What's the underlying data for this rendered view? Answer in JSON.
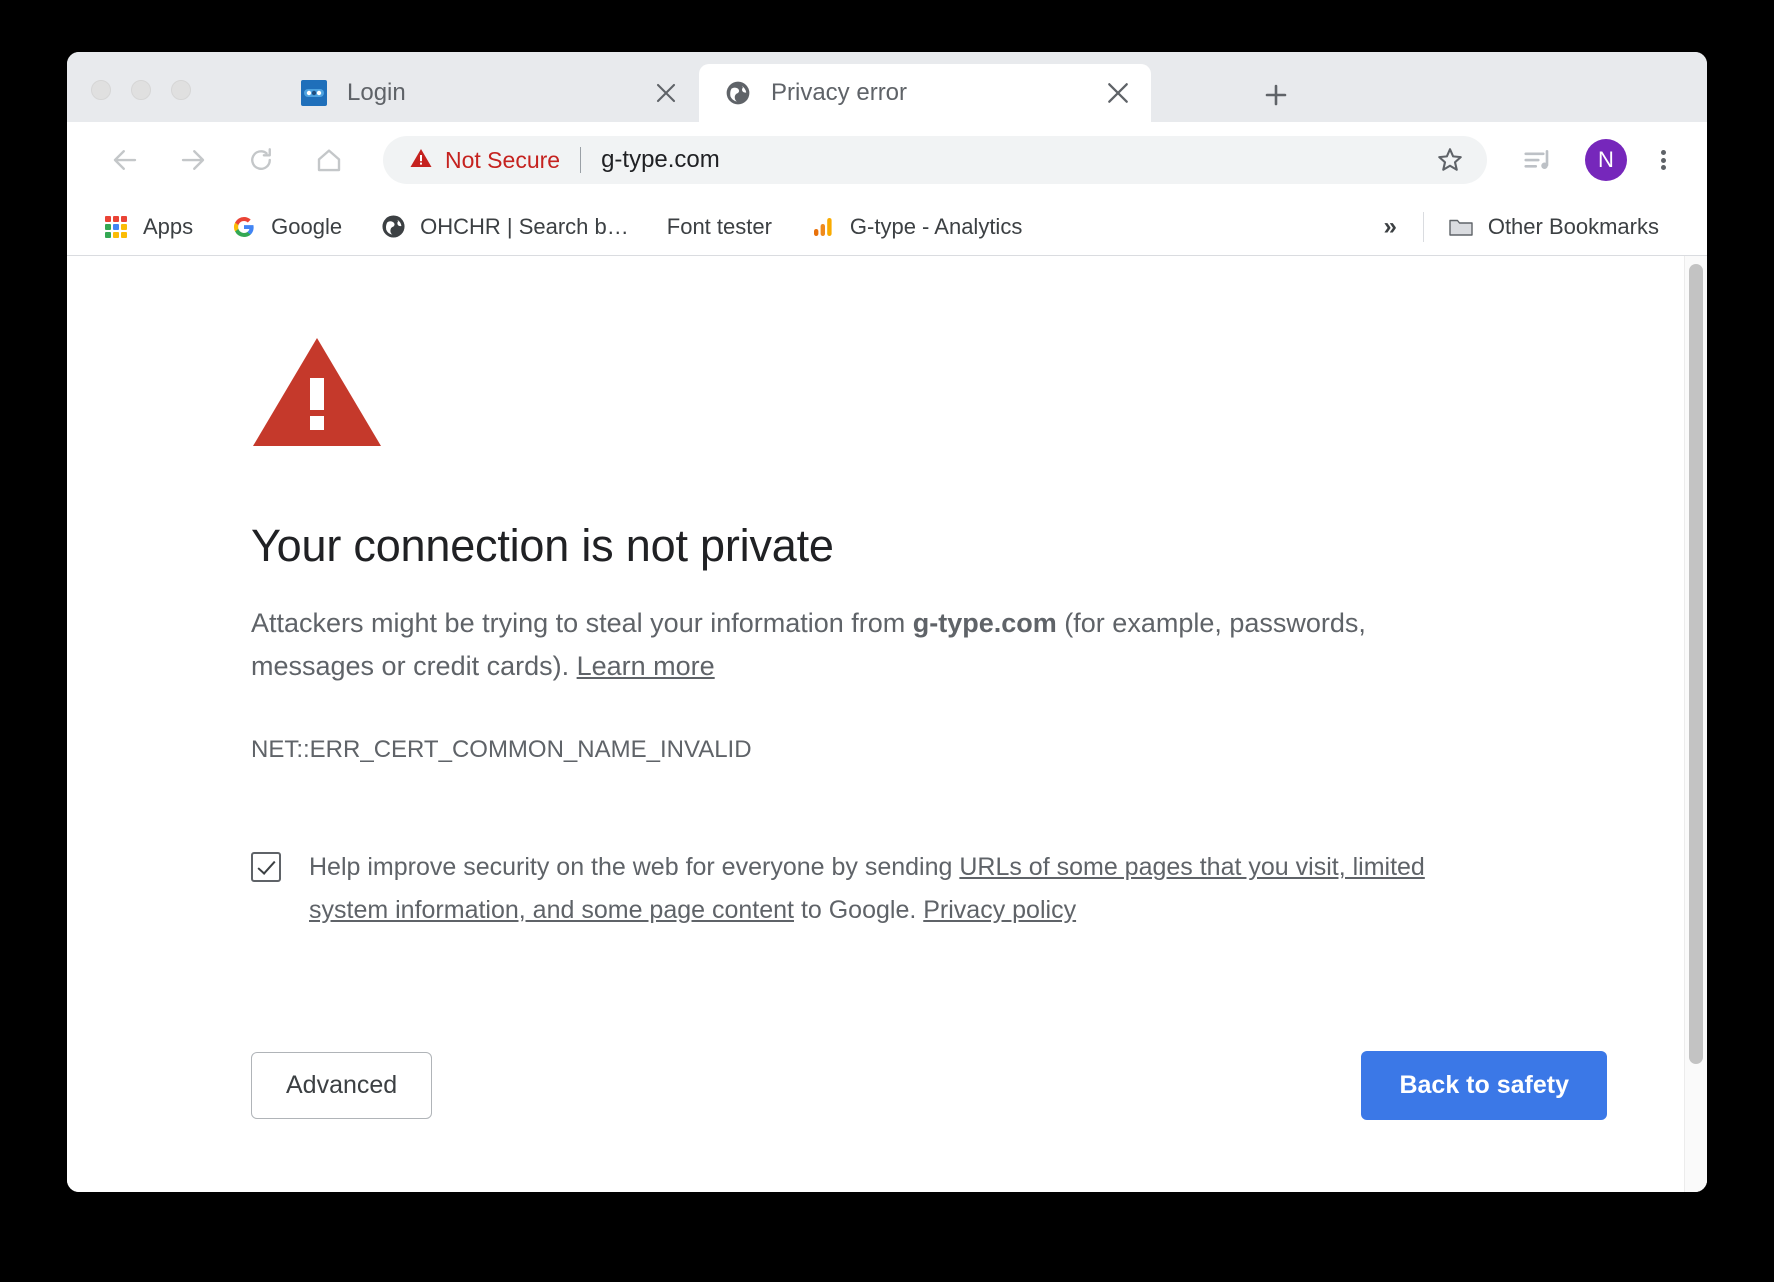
{
  "window": {
    "traffic_lights": [
      "close",
      "minimize",
      "maximize"
    ]
  },
  "tabs": [
    {
      "title": "Login",
      "favicon": "login-app-favicon",
      "active": false,
      "close_label": "✕"
    },
    {
      "title": "Privacy error",
      "favicon": "globe-favicon",
      "active": true,
      "close_label": "✕"
    }
  ],
  "new_tab_label": "+",
  "toolbar": {
    "back_icon": "back-arrow-icon",
    "forward_icon": "forward-arrow-icon",
    "reload_icon": "reload-icon",
    "home_icon": "home-icon",
    "security_label": "Not Secure",
    "security_color": "#c5221f",
    "url": "g-type.com",
    "url_placeholder": "Search Google or type a URL",
    "bookmark_icon": "star-outline-icon",
    "media_icon": "media-playlist-icon",
    "profile_initial": "N",
    "profile_color": "#7627bb",
    "menu_icon": "three-dot-menu-icon"
  },
  "bookmarks": {
    "items": [
      {
        "label": "Apps",
        "icon": "apps-grid-icon"
      },
      {
        "label": "Google",
        "icon": "google-g-icon"
      },
      {
        "label": "OHCHR | Search b…",
        "icon": "globe-icon"
      },
      {
        "label": "Font tester",
        "icon": "none"
      },
      {
        "label": "G-type - Analytics",
        "icon": "google-analytics-icon"
      }
    ],
    "overflow_label": "»",
    "other_bookmarks_label": "Other Bookmarks",
    "other_bookmarks_icon": "folder-icon"
  },
  "interstitial": {
    "icon": "red-warning-triangle-icon",
    "icon_color": "#c5392b",
    "heading": "Your connection is not private",
    "paragraph_part1": "Attackers might be trying to steal your information from ",
    "paragraph_domain": "g-type.com",
    "paragraph_part2": " (for example, passwords, messages or credit cards). ",
    "learn_more_link": "Learn more",
    "error_code": "NET::ERR_CERT_COMMON_NAME_INVALID",
    "optin_checked": true,
    "optin_part1": "Help improve security on the web for everyone by sending ",
    "optin_link1": "URLs of some pages that you visit, limited system information, and some page content",
    "optin_part2": " to Google. ",
    "optin_link2": "Privacy policy",
    "advanced_button": "Advanced",
    "back_to_safety_button": "Back to safety",
    "back_to_safety_color": "#3b78e7"
  }
}
